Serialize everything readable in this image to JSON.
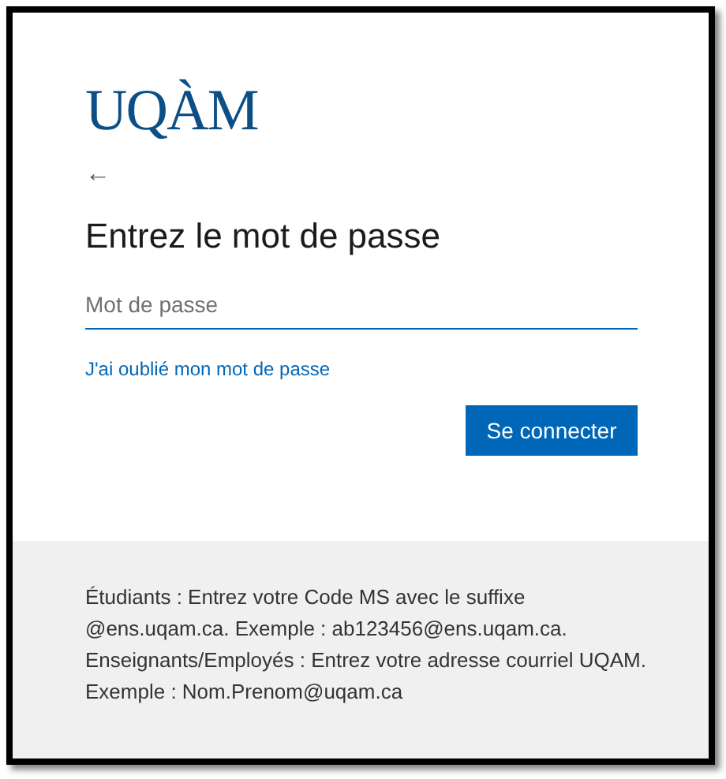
{
  "logo": "UQÀM",
  "back_button": "←",
  "title": "Entrez le mot de passe",
  "password_field": {
    "placeholder": "Mot de passe"
  },
  "forgot_link": "J'ai oublié mon mot de passe",
  "submit_button": "Se connecter",
  "footer_text": "Étudiants : Entrez votre Code MS avec le suffixe @ens.uqam.ca. Exemple : ab123456@ens.uqam.ca. Enseignants/Employés : Entrez votre adresse courriel UQAM. Exemple : Nom.Prenom@uqam.ca"
}
